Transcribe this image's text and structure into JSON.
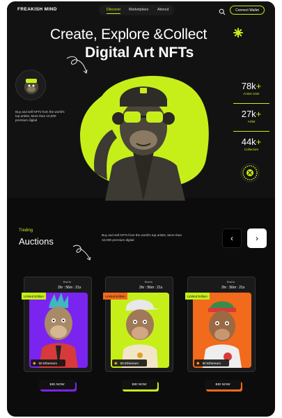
{
  "brand": "FREAKISH MIND",
  "nav": {
    "links": [
      "Discover",
      "Marketplace",
      "Aboout"
    ],
    "active": 0
  },
  "connect_label": "Connect Wallet",
  "hero": {
    "title_line1": "Create, Explore &Collect",
    "title_line2": "Digital Art NFTs",
    "description": "Buy and sell NFTs from the world's top artists, More than 10,000 premium digital"
  },
  "stats": [
    {
      "value": "78k",
      "plus": "+",
      "label": "Active User"
    },
    {
      "value": "27k",
      "plus": "+",
      "label": "Artist"
    },
    {
      "value": "44k",
      "plus": "+",
      "label": "Collectors"
    }
  ],
  "auctions": {
    "eyebrow": "Treding",
    "title": "Auctions",
    "description": "Buy and sell NFTs from the world's top artists, More than 10,000 premium digital",
    "prev_icon": "chevron-left-icon",
    "next_icon": "chevron-right-icon",
    "cards": [
      {
        "ends_label": "End in",
        "time": "2hr : 56m : 21s",
        "badge": "Limited Edition",
        "price": "50 Ethereum",
        "bid_label": "BID NOW",
        "accent": "#7a24f0",
        "badge_color": "#c6ef1a"
      },
      {
        "ends_label": "End in",
        "time": "2hr : 56m : 21s",
        "badge": "Limited Edition",
        "price": "50 Ethereum",
        "bid_label": "BID NOW",
        "accent": "#c6ef1a",
        "badge_color": "#f26a1b"
      },
      {
        "ends_label": "End in",
        "time": "2hr : 56m : 21s",
        "badge": "Limited Edition",
        "price": "50 Ethereum",
        "bid_label": "BID NOW",
        "accent": "#f26a1b",
        "badge_color": "#c6ef1a"
      }
    ]
  },
  "colors": {
    "accent": "#c6ef1a",
    "background": "#0c0c0c",
    "orange": "#f26a1b",
    "purple": "#7a24f0"
  }
}
